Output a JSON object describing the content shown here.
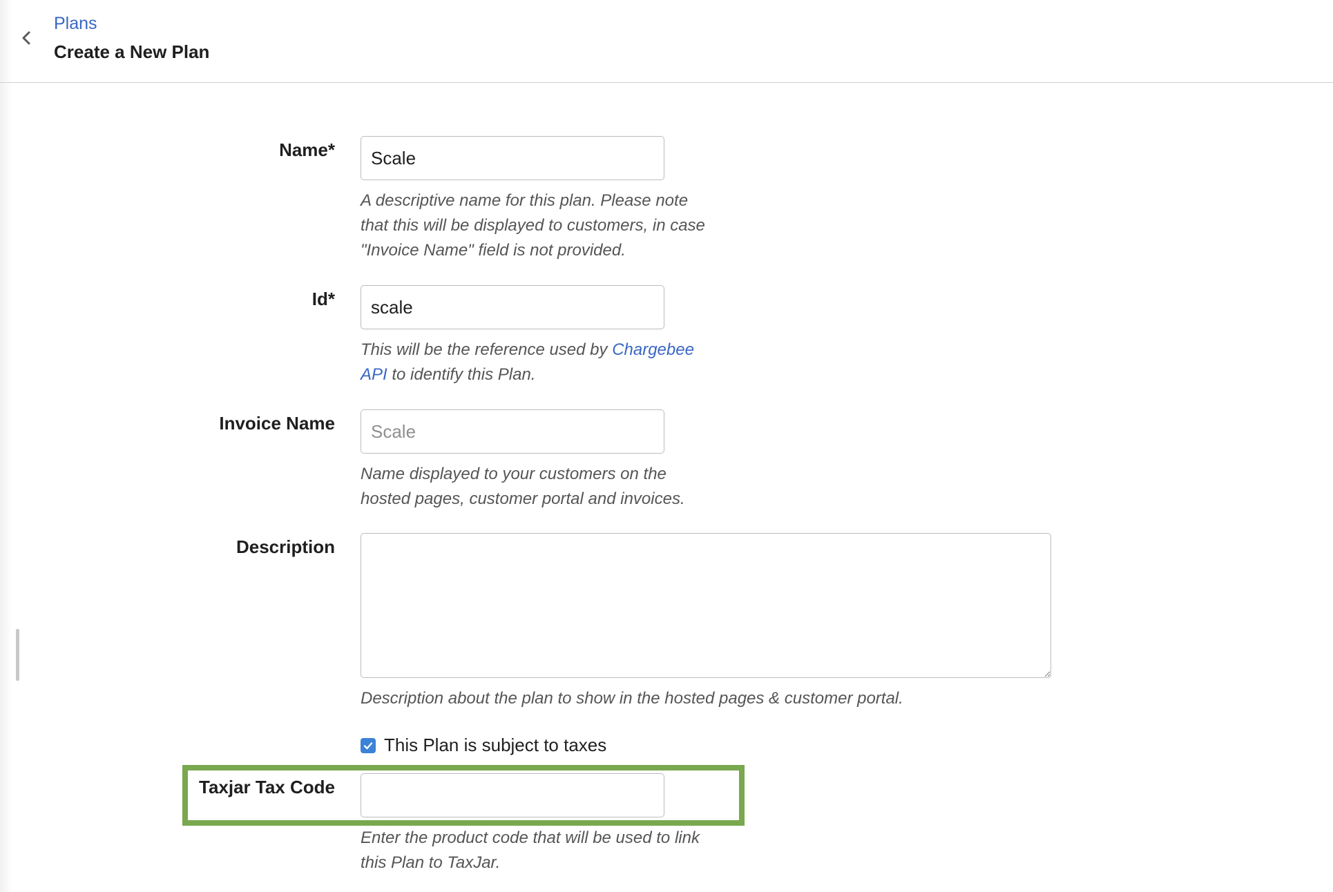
{
  "header": {
    "breadcrumb": "Plans",
    "title": "Create a New Plan"
  },
  "form": {
    "name": {
      "label": "Name*",
      "value": "Scale",
      "help": [
        "A descriptive name for this plan. Please note",
        "that this will be displayed to customers, in case",
        "\"Invoice Name\" field is not provided."
      ]
    },
    "id": {
      "label": "Id*",
      "value": "scale",
      "help_prefix": "This will be the reference used by ",
      "help_link": "Chargebee",
      "help_link2": "API",
      "help_suffix": " to identify this Plan."
    },
    "invoice_name": {
      "label": "Invoice Name",
      "placeholder": "Scale",
      "help": [
        "Name displayed to your customers on the",
        "hosted pages, customer portal and invoices."
      ]
    },
    "description": {
      "label": "Description",
      "value": "",
      "help": "Description about the plan to show in the hosted pages & customer portal."
    },
    "taxable": {
      "label": "This Plan is subject to taxes",
      "checked": true
    },
    "taxjar": {
      "label": "Taxjar Tax Code",
      "value": "",
      "help": [
        "Enter the product code that will be used to link",
        "this Plan to TaxJar."
      ]
    }
  },
  "colors": {
    "link": "#3a67c4",
    "highlight": "#79a84f",
    "checkbox": "#3b82d8"
  },
  "icons": {
    "back": "chevron-left-icon",
    "check": "check-icon"
  }
}
